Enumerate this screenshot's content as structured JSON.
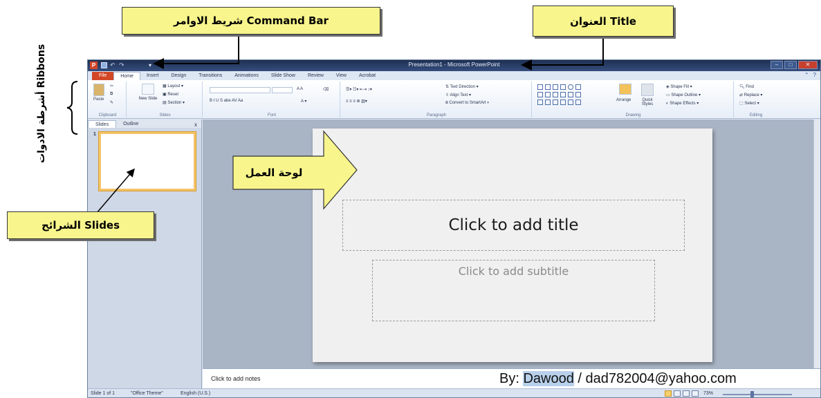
{
  "window": {
    "title": "Presentation1 - Microsoft PowerPoint",
    "app_icon_letter": "P",
    "controls": [
      "–",
      "□",
      "✕"
    ]
  },
  "ribbon_tabs": [
    "File",
    "Home",
    "Insert",
    "Design",
    "Transitions",
    "Animations",
    "Slide Show",
    "Review",
    "View",
    "Acrobat"
  ],
  "ribbon": {
    "clipboard": {
      "paste": "Paste",
      "label": "Clipboard"
    },
    "slides": {
      "new_slide": "New Slide",
      "layout": "Layout",
      "reset": "Reset",
      "section": "Section",
      "label": "Slides"
    },
    "font": {
      "label": "Font",
      "format_buttons": "B  I  U  S  abe  AV  Aa",
      "grow": "A A"
    },
    "paragraph": {
      "label": "Paragraph",
      "text_direction": "Text Direction",
      "align_text": "Align Text",
      "convert_smartart": "Convert to SmartArt"
    },
    "drawing": {
      "label": "Drawing",
      "arrange": "Arrange",
      "quick_styles": "Quick Styles",
      "shape_fill": "Shape Fill",
      "shape_outline": "Shape Outline",
      "shape_effects": "Shape Effects"
    },
    "editing": {
      "label": "Editing",
      "find": "Find",
      "replace": "Replace",
      "select": "Select"
    }
  },
  "left_pane": {
    "tabs": [
      "Slides",
      "Outline"
    ],
    "close": "x",
    "slide_number": "1"
  },
  "slide": {
    "title_placeholder": "Click to add title",
    "subtitle_placeholder": "Click to add subtitle"
  },
  "notes": {
    "placeholder": "Click to add notes"
  },
  "status_bar": {
    "slide_info": "Slide 1 of 1",
    "theme": "\"Office Theme\"",
    "language": "English (U.S.)",
    "zoom": "73%"
  },
  "credit": {
    "prefix": "By: ",
    "name": "Dawood",
    "email": " / dad782004@yahoo.com"
  },
  "annotations": {
    "command_bar": "شريط الاوامر Command Bar",
    "title": "العنوان Title",
    "slides": "الشرائح Slides",
    "work_pane": "لوحة العمل",
    "ribbons": "أشرطة الادوات Ribbons"
  },
  "colors": {
    "callout_fill": "#f8f58c",
    "file_tab": "#d24726",
    "title_bar": "#1e2f52",
    "thumb_border": "#f3c46a"
  }
}
